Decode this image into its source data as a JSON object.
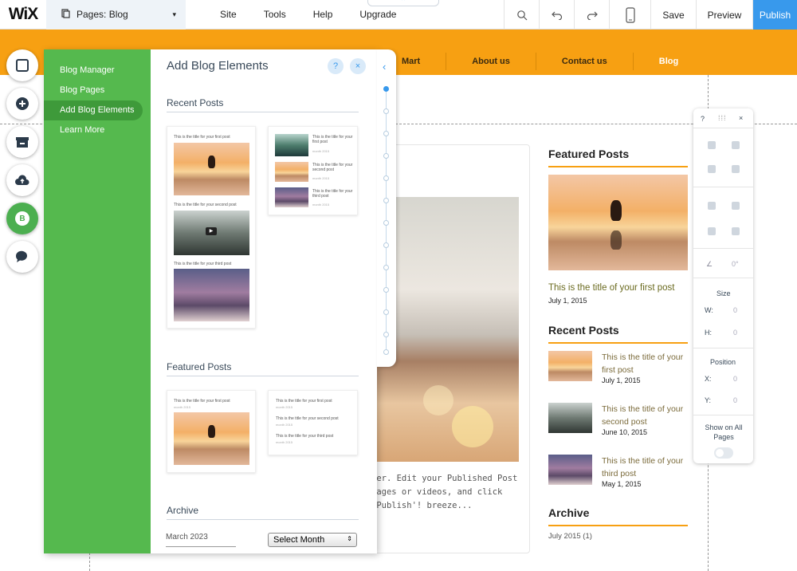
{
  "topbar": {
    "logo": "WiX",
    "pages_label": "Pages: Blog",
    "menu": [
      "Site",
      "Tools",
      "Help",
      "Upgrade"
    ],
    "save": "Save",
    "preview": "Preview",
    "publish": "Publish"
  },
  "site_nav": [
    "Mart",
    "About us",
    "Contact us",
    "Blog"
  ],
  "left_panel": {
    "menu": [
      "Blog Manager",
      "Blog Pages",
      "Add Blog Elements",
      "Learn More"
    ],
    "selected": "Add Blog Elements"
  },
  "blog_panel": {
    "title": "Add Blog Elements",
    "help": "?",
    "close": "×",
    "sections": {
      "recent": "Recent Posts",
      "featured": "Featured Posts",
      "archive": "Archive"
    },
    "sample_titles": {
      "first": "This is the title for your first post",
      "second": "This is the title for your second post",
      "third": "This is the title for your third post"
    },
    "sample_date": "month 2015",
    "archive_month": "March 2023",
    "select_month": "Select Month"
  },
  "main_post": {
    "text": "ger.  Edit your Published Post mages or videos, and click 'Publish'! breeze..."
  },
  "sidebar": {
    "featured_heading": "Featured Posts",
    "featured_title": "This is the title of your first post",
    "featured_date": "July 1, 2015",
    "recent_heading": "Recent Posts",
    "recent": [
      {
        "title": "This is the title of your first post",
        "date": "July 1, 2015"
      },
      {
        "title": "This is the title of your second post",
        "date": "June 10, 2015"
      },
      {
        "title": "This is the title of your third post",
        "date": "May 1, 2015"
      }
    ],
    "archive_heading": "Archive",
    "archive_item": "July 2015 (1)"
  },
  "inspector": {
    "help": "?",
    "close": "×",
    "angle": "0°",
    "size_label": "Size",
    "w_label": "W:",
    "h_label": "H:",
    "w_value": "0",
    "h_value": "0",
    "position_label": "Position",
    "x_label": "X:",
    "y_label": "Y:",
    "x_value": "0",
    "y_value": "0",
    "show_all": "Show on All Pages"
  },
  "colors": {
    "brand_orange": "#f7a012",
    "panel_green": "#55b94e",
    "publish_blue": "#3899ec"
  }
}
